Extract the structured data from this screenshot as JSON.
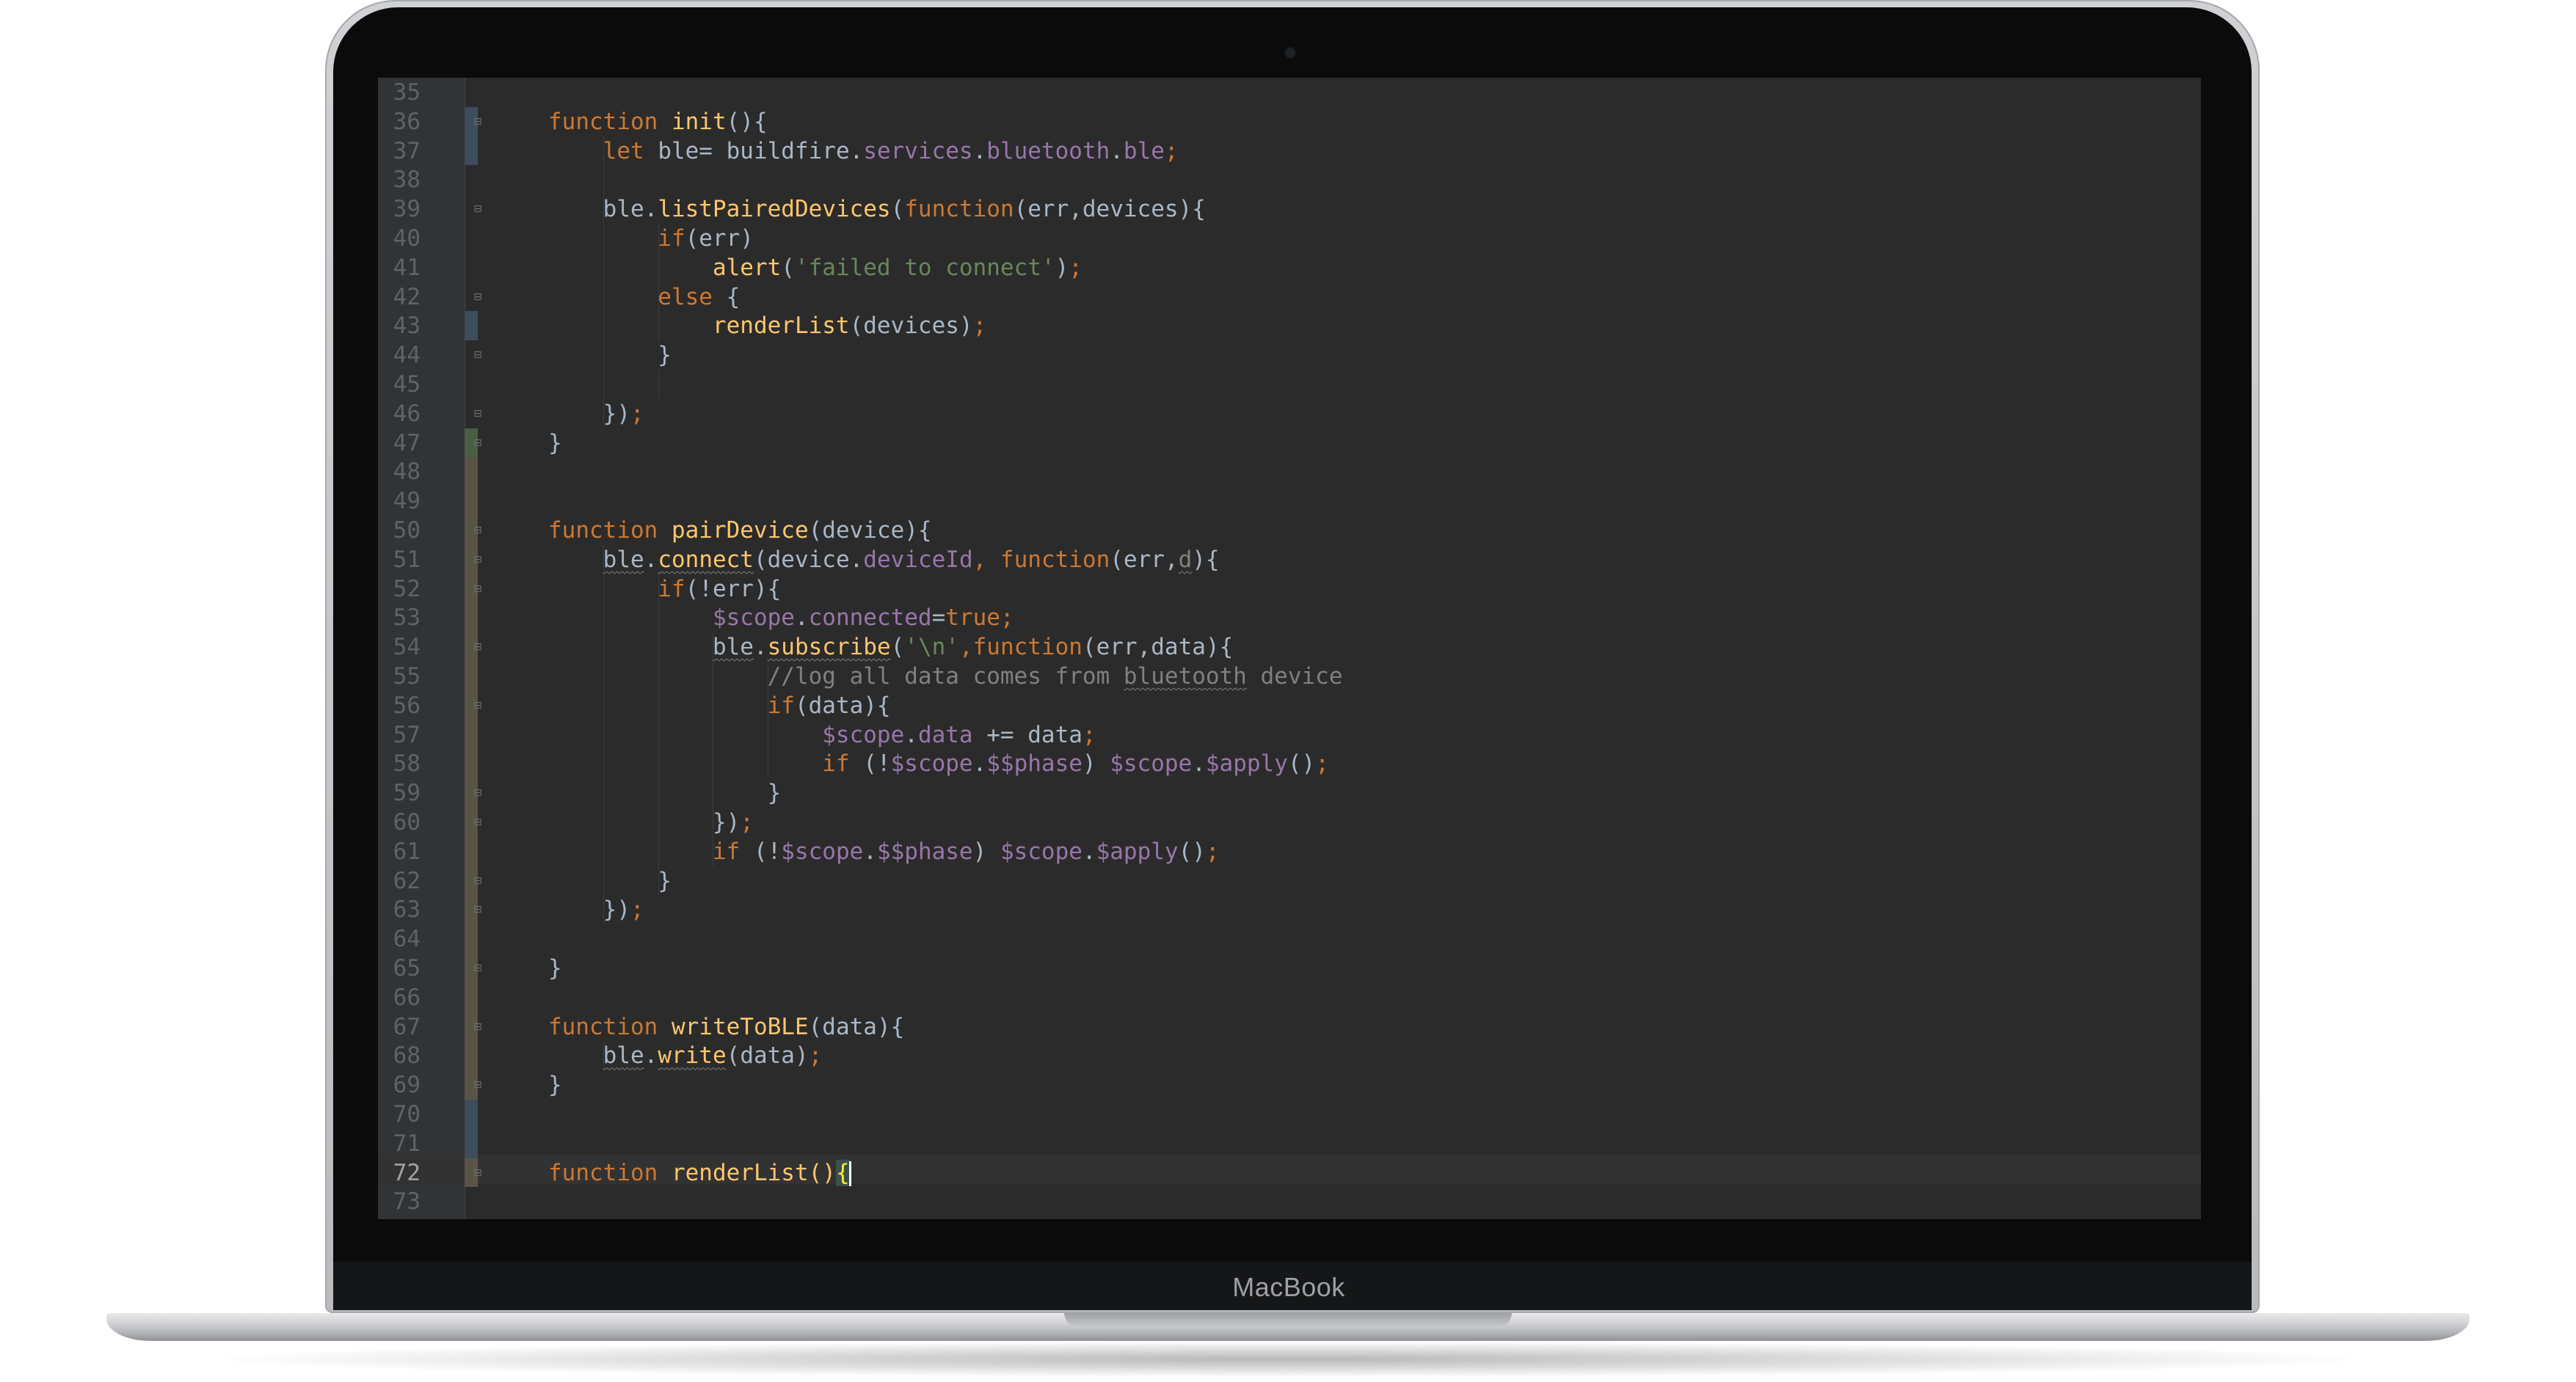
{
  "device": {
    "brand": "MacBook"
  },
  "editor": {
    "current_line": "72",
    "lines": [
      {
        "n": "35",
        "t": []
      },
      {
        "n": "36",
        "t": [
          [
            "kw",
            "function "
          ],
          [
            "fn",
            "init"
          ],
          [
            "pl",
            "(){"
          ]
        ]
      },
      {
        "n": "37",
        "t": [
          [
            "kw",
            "    let "
          ],
          [
            "pl",
            "ble= buildfire."
          ],
          [
            "prop",
            "services"
          ],
          [
            "pl",
            "."
          ],
          [
            "prop",
            "bluetooth"
          ],
          [
            "pl",
            "."
          ],
          [
            "prop",
            "ble"
          ],
          [
            "kw",
            ";"
          ]
        ]
      },
      {
        "n": "38",
        "t": []
      },
      {
        "n": "39",
        "t": [
          [
            "pl",
            "    ble."
          ],
          [
            "fn",
            "listPairedDevices"
          ],
          [
            "pl",
            "("
          ],
          [
            "kw",
            "function"
          ],
          [
            "pl",
            "(err,devices){"
          ]
        ]
      },
      {
        "n": "40",
        "t": [
          [
            "kw",
            "        if"
          ],
          [
            "pl",
            "(err)"
          ]
        ]
      },
      {
        "n": "41",
        "t": [
          [
            "fn",
            "            alert"
          ],
          [
            "pl",
            "("
          ],
          [
            "str",
            "'failed to connect'"
          ],
          [
            "pl",
            ")"
          ],
          [
            "kw",
            ";"
          ]
        ]
      },
      {
        "n": "42",
        "t": [
          [
            "kw",
            "        else "
          ],
          [
            "pl",
            "{"
          ]
        ]
      },
      {
        "n": "43",
        "t": [
          [
            "fn",
            "            renderList"
          ],
          [
            "pl",
            "(devices)"
          ],
          [
            "kw",
            ";"
          ]
        ]
      },
      {
        "n": "44",
        "t": [
          [
            "pl",
            "        }"
          ]
        ]
      },
      {
        "n": "45",
        "t": []
      },
      {
        "n": "46",
        "t": [
          [
            "pl",
            "    })"
          ],
          [
            "kw",
            ";"
          ]
        ]
      },
      {
        "n": "47",
        "t": [
          [
            "pl",
            "}"
          ]
        ]
      },
      {
        "n": "48",
        "t": []
      },
      {
        "n": "49",
        "t": []
      },
      {
        "n": "50",
        "t": [
          [
            "kw",
            "function "
          ],
          [
            "fn",
            "pairDevice"
          ],
          [
            "pl",
            "(device){"
          ]
        ]
      },
      {
        "n": "51",
        "t": [
          [
            "pl",
            "    "
          ],
          [
            "wpl",
            "ble"
          ],
          [
            "pl",
            "."
          ],
          [
            "wfn",
            "connect"
          ],
          [
            "pl",
            "(device."
          ],
          [
            "prop",
            "deviceId"
          ],
          [
            "kw",
            ", function"
          ],
          [
            "pl",
            "(err,"
          ],
          [
            "wcm",
            "d"
          ],
          [
            "pl",
            "){"
          ]
        ]
      },
      {
        "n": "52",
        "t": [
          [
            "kw",
            "        if"
          ],
          [
            "pl",
            "(!err){"
          ]
        ]
      },
      {
        "n": "53",
        "t": [
          [
            "prop",
            "            $scope"
          ],
          [
            "pl",
            "."
          ],
          [
            "prop",
            "connected"
          ],
          [
            "pl",
            "="
          ],
          [
            "kw",
            "true;"
          ]
        ]
      },
      {
        "n": "54",
        "t": [
          [
            "pl",
            "            "
          ],
          [
            "wpl",
            "ble"
          ],
          [
            "pl",
            "."
          ],
          [
            "wfn",
            "subscribe"
          ],
          [
            "pl",
            "("
          ],
          [
            "str",
            "'\\n'"
          ],
          [
            "kw",
            ",function"
          ],
          [
            "pl",
            "(err,data){"
          ]
        ]
      },
      {
        "n": "55",
        "t": [
          [
            "cm",
            "                //log all data comes from "
          ],
          [
            "wcm",
            "bluetooth"
          ],
          [
            "cm",
            " device"
          ]
        ]
      },
      {
        "n": "56",
        "t": [
          [
            "kw",
            "                if"
          ],
          [
            "pl",
            "(data){"
          ]
        ]
      },
      {
        "n": "57",
        "t": [
          [
            "prop",
            "                    $scope"
          ],
          [
            "pl",
            "."
          ],
          [
            "prop",
            "data"
          ],
          [
            "pl",
            " += data"
          ],
          [
            "kw",
            ";"
          ]
        ]
      },
      {
        "n": "58",
        "t": [
          [
            "kw",
            "                    if "
          ],
          [
            "pl",
            "(!"
          ],
          [
            "prop",
            "$scope"
          ],
          [
            "pl",
            "."
          ],
          [
            "prop",
            "$$phase"
          ],
          [
            "pl",
            ") "
          ],
          [
            "prop",
            "$scope"
          ],
          [
            "pl",
            "."
          ],
          [
            "prop",
            "$apply"
          ],
          [
            "pl",
            "()"
          ],
          [
            "kw",
            ";"
          ]
        ]
      },
      {
        "n": "59",
        "t": [
          [
            "pl",
            "                }"
          ]
        ]
      },
      {
        "n": "60",
        "t": [
          [
            "pl",
            "            })"
          ],
          [
            "kw",
            ";"
          ]
        ]
      },
      {
        "n": "61",
        "t": [
          [
            "kw",
            "            if "
          ],
          [
            "pl",
            "(!"
          ],
          [
            "prop",
            "$scope"
          ],
          [
            "pl",
            "."
          ],
          [
            "prop",
            "$$phase"
          ],
          [
            "pl",
            ") "
          ],
          [
            "prop",
            "$scope"
          ],
          [
            "pl",
            "."
          ],
          [
            "prop",
            "$apply"
          ],
          [
            "pl",
            "()"
          ],
          [
            "kw",
            ";"
          ]
        ]
      },
      {
        "n": "62",
        "t": [
          [
            "pl",
            "        }"
          ]
        ]
      },
      {
        "n": "63",
        "t": [
          [
            "pl",
            "    })"
          ],
          [
            "kw",
            ";"
          ]
        ]
      },
      {
        "n": "64",
        "t": []
      },
      {
        "n": "65",
        "t": [
          [
            "pl",
            "}"
          ]
        ]
      },
      {
        "n": "66",
        "t": []
      },
      {
        "n": "67",
        "t": [
          [
            "kw",
            "function "
          ],
          [
            "fn",
            "writeToBLE"
          ],
          [
            "pl",
            "(data){"
          ]
        ]
      },
      {
        "n": "68",
        "t": [
          [
            "pl",
            "    "
          ],
          [
            "wpl",
            "ble"
          ],
          [
            "pl",
            "."
          ],
          [
            "wfn",
            "write"
          ],
          [
            "pl",
            "(data)"
          ],
          [
            "kw",
            ";"
          ]
        ]
      },
      {
        "n": "69",
        "t": [
          [
            "pl",
            "}"
          ]
        ]
      },
      {
        "n": "70",
        "t": []
      },
      {
        "n": "71",
        "t": []
      },
      {
        "n": "72",
        "t": [
          [
            "kw",
            "function "
          ],
          [
            "fn",
            "renderList"
          ],
          [
            "fn",
            "()"
          ],
          [
            "brace",
            "{"
          ]
        ]
      },
      {
        "n": "73",
        "t": []
      }
    ]
  },
  "colors": {
    "keyword": "#cc7832",
    "function": "#ffc66d",
    "property": "#9876aa",
    "string": "#6a8759",
    "comment": "#808080",
    "plain": "#a9b7c6",
    "background": "#2b2b2b"
  }
}
